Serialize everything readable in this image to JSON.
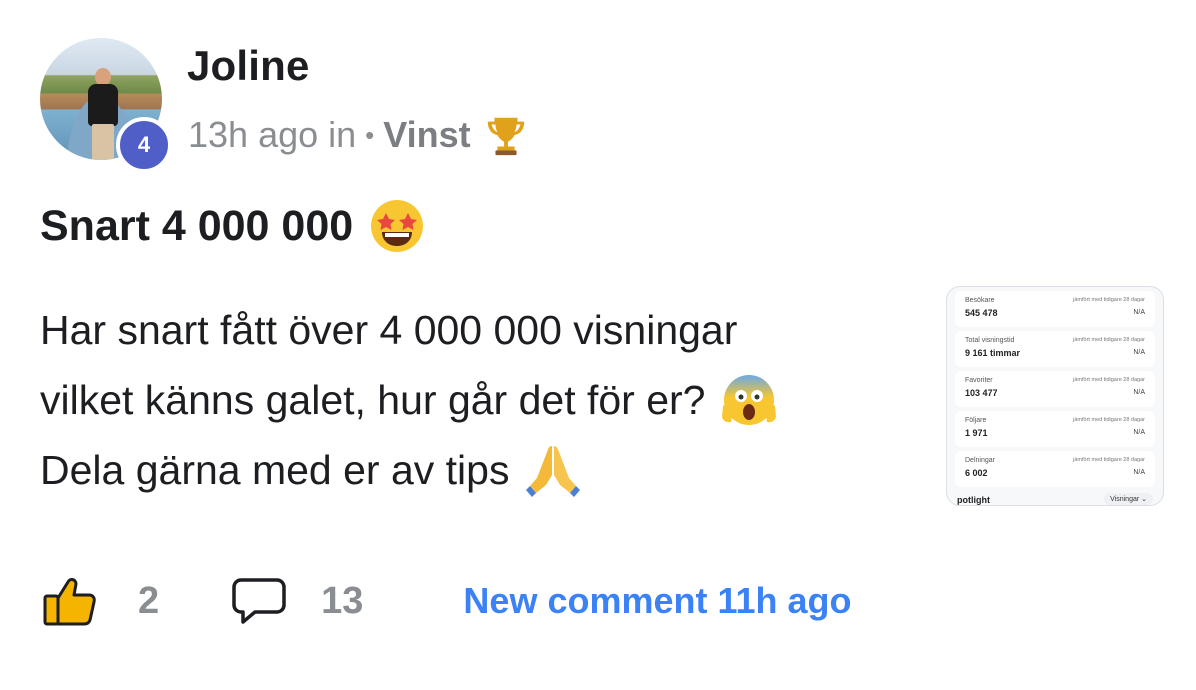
{
  "post": {
    "author": "Joline",
    "level_badge": "4",
    "meta_time": "13h ago in",
    "meta_separator": "•",
    "meta_category": "Vinst",
    "title": "Snart 4 000 000",
    "body_lines": [
      "Har snart fått över 4 000 000 visningar",
      "vilket känns galet, hur går det för er?",
      "Dela gärna med er av tips"
    ],
    "icons": {
      "category": "trophy-icon",
      "title": "star-struck-emoji",
      "line2": "screaming-face-emoji",
      "line3": "folded-hands-emoji"
    }
  },
  "attachment": {
    "stats": [
      {
        "label": "Besökare",
        "value": "545 478",
        "compare": "jämfört med tidigare 28 dagar",
        "delta": "N/A"
      },
      {
        "label": "Total visningstid",
        "value": "9 161 timmar",
        "compare": "jämfört med tidigare 28 dagar",
        "delta": "N/A"
      },
      {
        "label": "Favoriter",
        "value": "103 477",
        "compare": "jämfört med tidigare 28 dagar",
        "delta": "N/A"
      },
      {
        "label": "Följare",
        "value": "1 971",
        "compare": "jämfört med tidigare 28 dagar",
        "delta": "N/A"
      },
      {
        "label": "Delningar",
        "value": "6 002",
        "compare": "jämfört med tidigare 28 dagar",
        "delta": "N/A"
      }
    ],
    "footer_label": "potlight",
    "dropdown": "Visningar ⌄"
  },
  "actions": {
    "likes": "2",
    "comments": "13",
    "new_comment": "New comment 11h ago"
  },
  "colors": {
    "accent": "#3b82f6",
    "badge": "#4f5fc7",
    "muted": "#8a8d91",
    "text": "#1c1e21"
  }
}
